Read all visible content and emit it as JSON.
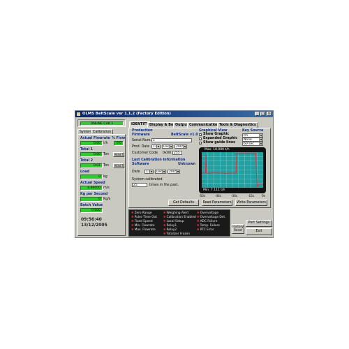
{
  "window": {
    "title": "OLMS BeltScale ver 1.1.2  (Factory Edition)"
  },
  "left_panel": {
    "status": "ONLINE  CHK 1",
    "tabs": [
      "System",
      "Calibration"
    ],
    "actual_flowrate": {
      "label": "Actual Flowrate",
      "value": "0.00",
      "unit": "t/h",
      "right_label": "% Flow",
      "right_value": "0.0"
    },
    "total1": {
      "label": "Total 1",
      "value": "0.00",
      "unit": "Ton",
      "button": "RESET"
    },
    "total2": {
      "label": "Total 2",
      "value": "0.01",
      "unit": "Ton",
      "button": "RESET"
    },
    "load": {
      "label": "Load",
      "value": "0",
      "unit": "kg"
    },
    "actual_speed": {
      "label": "Actual Speed",
      "value": "0.00000",
      "unit": "m/s"
    },
    "kg_per_second": {
      "label": "Kg per Second",
      "value": "0",
      "unit": "Kg/s"
    },
    "batch_value": {
      "label": "Batch Value",
      "value": "0.000"
    },
    "time": "09:56:40",
    "date": "13/12/2005"
  },
  "main_tabs": [
    "IDENTITY",
    "Display & Belt",
    "Output",
    "Communication",
    "Tools & Diagnostics"
  ],
  "production": {
    "heading": "Production",
    "firmware_label": "Firmware",
    "firmware_value": "BeltScale v1.0",
    "serial_label": "Serial Num.",
    "serial_value": "1",
    "prod_date_label": "Prod. Date",
    "prod_day": "11",
    "prod_month": "Dec",
    "prod_year": "2005",
    "customer_label": "Customer Code",
    "customer_code_prefix": "0x00",
    "customer_code": "255"
  },
  "last_calibration": {
    "heading": "Last Calibration Information",
    "software_label": "Software",
    "software_value": "Unknown",
    "date_label": "Date",
    "day": "17",
    "month": "Dec",
    "year": "2005",
    "system_calibrated_label": "System calibrated",
    "times_value": "25",
    "times_suffix": "times in the past."
  },
  "graphical_view": {
    "heading": "Graphical View",
    "options": [
      {
        "label": "Show Graphic",
        "checked": true
      },
      {
        "label": "Expanded Graphic",
        "checked": true
      },
      {
        "label": "Show guide lines",
        "checked": true
      }
    ],
    "key_source_label": "Key Source",
    "key_source_value": "t/h",
    "key_source_value2": "None",
    "interval_value": "60 sec",
    "max_label": "Max: 10.000 t/h",
    "min_label": "Min: 7.111 t/h",
    "x_ticks": [
      "-50s",
      "-44s",
      "-30s",
      "-15s",
      "0s"
    ]
  },
  "chart_data": {
    "type": "line",
    "x": [
      -50,
      -47,
      -46.5,
      -46,
      -45,
      -43,
      -40,
      -35,
      -30,
      -25,
      -22,
      -21.5,
      -21,
      -18,
      -15,
      -10,
      -6,
      -5,
      -3,
      -1,
      0
    ],
    "series": [
      {
        "values": [
          8.3,
          8.3,
          9.8,
          8.3,
          8.28,
          8.3,
          8.32,
          8.3,
          8.28,
          8.3,
          8.3,
          9.9,
          9.9,
          9.9,
          9.9,
          9.9,
          9.9,
          7.2,
          7.4,
          7.4,
          7.4
        ]
      }
    ],
    "ylim": [
      7.111,
      10.0
    ],
    "xlim": [
      -50,
      0
    ],
    "grid": true,
    "colors": {
      "background": "#20a0a0",
      "line": "#e03040",
      "grid": "#c8e0e0"
    }
  },
  "buttons": {
    "get_defaults": "Get Defaults",
    "read_parameters": "Read Parameters",
    "write_parameters": "Write Parameters",
    "port_settings": "Port Settings",
    "factory_reset": "Factory Reset",
    "exit": "Exit"
  },
  "alarms": {
    "col1": [
      "Zero Range",
      "Pulse Time Out",
      "Fixed Speed",
      "Min. Flowrate",
      "Max. Flowrate"
    ],
    "col2": [
      "Weighing Alert",
      "Calibration Enabled",
      "Local Setup",
      "Relay1",
      "Relay2",
      "Totalizer Frozen"
    ],
    "col3": [
      "Overvoltage",
      "Overvoltage Det.",
      "ADC Failure",
      "Temp. Failure",
      "RTC Error"
    ]
  },
  "colors": {
    "window_bg": "#c9c9c1",
    "title_bar": "#0a246a",
    "value_green": "#2ecc2e",
    "alarm_bg": "#1a1a1a"
  }
}
